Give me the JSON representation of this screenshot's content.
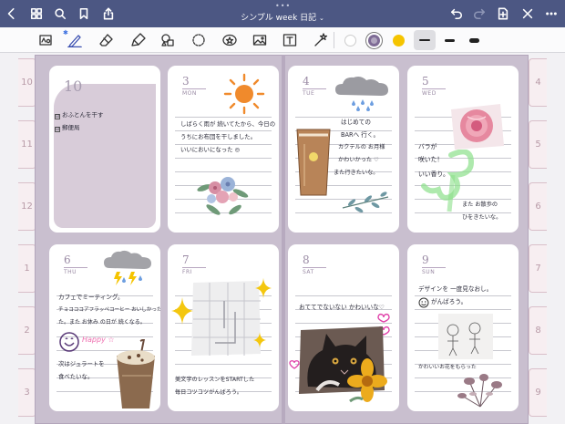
{
  "nav": {
    "title": "シンプル week 日記",
    "grab": "•••"
  },
  "toolbar": {
    "swatches": [
      "#ffffff",
      "#7e6b95",
      "#f5c400"
    ]
  },
  "tabs": {
    "left": [
      "10",
      "11",
      "12",
      "1",
      "2",
      "3"
    ],
    "right": [
      "4",
      "5",
      "6",
      "7",
      "8",
      "9"
    ]
  },
  "month": {
    "number": "10",
    "todos": [
      {
        "check": "☑",
        "text": "おふとんを干す"
      },
      {
        "check": "☑",
        "text": "郵便局"
      }
    ]
  },
  "days": [
    {
      "num": "3",
      "name": "MON",
      "lines": [
        "しばらく雨が 続いてたから、今日の",
        "うちにお布団を干しました。",
        "いいにおいになった ◎"
      ]
    },
    {
      "num": "4",
      "name": "TUE",
      "lines": [
        "はじめての",
        "BARへ 行く。",
        "カクテルの お月様",
        "かわいかった ♡",
        "また行きたいな。"
      ]
    },
    {
      "num": "5",
      "name": "WED",
      "lines": [
        "バラが",
        "咲いた！",
        "いい香り。",
        "また お散歩の",
        "ひをきたいな。"
      ]
    },
    {
      "num": "6",
      "name": "THU",
      "lines": [
        "カフェでミーティング。",
        "チョコココアフラッペコーヒー おいしかった",
        "た。また お休み の日が 続くなる。",
        "次はジュラートを",
        "食べたいな。"
      ],
      "happy": "Happy ☆"
    },
    {
      "num": "7",
      "name": "FRI",
      "lines": [
        "美文字のレッスンをSTARTした",
        "毎日コツコツがんばろう。"
      ]
    },
    {
      "num": "8",
      "name": "SAT",
      "lines": [
        "おててでないない かわいいな♡"
      ]
    },
    {
      "num": "9",
      "name": "SUN",
      "lines": [
        "デザインを 一度見なおし。",
        "がんばろう。",
        "かわいいお花をもらった"
      ]
    }
  ]
}
